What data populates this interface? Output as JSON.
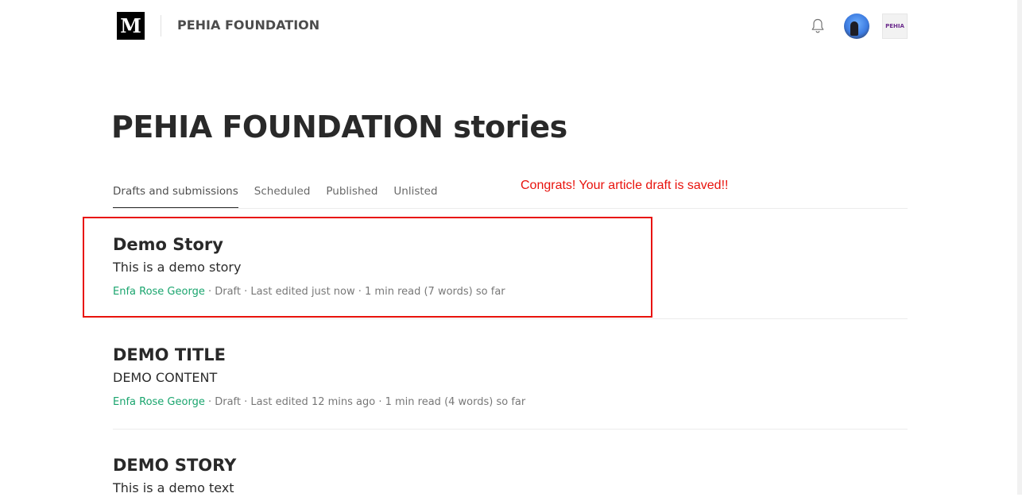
{
  "header": {
    "logo_letter": "M",
    "publication_name": "PEHIA FOUNDATION",
    "publication_avatar_text": "PEHIA",
    "icons": [
      "bell-icon",
      "user-avatar",
      "publication-avatar"
    ]
  },
  "page": {
    "title": "PEHIA FOUNDATION stories",
    "notice": "Congrats! Your article draft is saved!!"
  },
  "tabs": [
    {
      "label": "Drafts and submissions",
      "active": true
    },
    {
      "label": "Scheduled",
      "active": false
    },
    {
      "label": "Published",
      "active": false
    },
    {
      "label": "Unlisted",
      "active": false
    }
  ],
  "stories": [
    {
      "title": "Demo Story",
      "subtitle": "This is a demo story",
      "author": "Enfa Rose George",
      "meta": " · Draft · Last edited just now · 1 min read (7 words) so far"
    },
    {
      "title": "DEMO TITLE",
      "subtitle": "DEMO CONTENT",
      "author": "Enfa Rose George",
      "meta": " · Draft · Last edited 12 mins ago · 1 min read (4 words) so far"
    },
    {
      "title": "DEMO STORY",
      "subtitle": "This is a demo text",
      "author": "",
      "meta": ""
    }
  ],
  "colors": {
    "accent_green": "#1aa56e",
    "notice_red": "#e8120c",
    "highlight_red": "#e8120c"
  }
}
